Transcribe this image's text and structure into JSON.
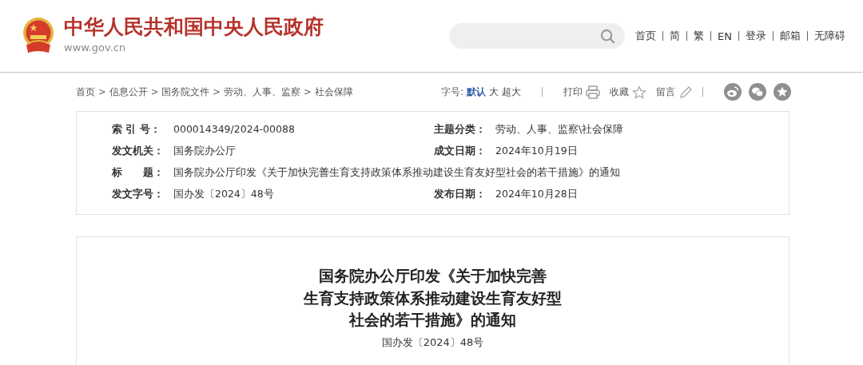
{
  "header": {
    "site_title": "中华人民共和国中央人民政府",
    "site_url": "www.gov.cn",
    "nav": [
      {
        "label": "首页"
      },
      {
        "label": "简"
      },
      {
        "label": "繁"
      },
      {
        "label": "EN"
      },
      {
        "label": "登录"
      },
      {
        "label": "邮箱"
      },
      {
        "label": "无障碍"
      }
    ]
  },
  "breadcrumb": {
    "separator": ">",
    "items": [
      {
        "label": "首页"
      },
      {
        "label": "信息公开"
      },
      {
        "label": "国务院文件"
      },
      {
        "label": "劳动、人事、监察"
      },
      {
        "label": "社会保障"
      }
    ]
  },
  "toolbar": {
    "font_label": "字号:",
    "font_sizes": [
      {
        "label": "默认",
        "selected": true
      },
      {
        "label": "大",
        "selected": false
      },
      {
        "label": "超大",
        "selected": false
      }
    ],
    "actions": [
      {
        "label": "打印",
        "kind": "print"
      },
      {
        "label": "收藏",
        "kind": "favorite"
      },
      {
        "label": "留言",
        "kind": "comment"
      }
    ],
    "share": [
      {
        "kind": "weibo"
      },
      {
        "kind": "wechat"
      },
      {
        "kind": "star"
      }
    ]
  },
  "meta": [
    {
      "label": "索 引 号：",
      "value": "000014349/2024-00088",
      "kind": "half"
    },
    {
      "label": "主题分类：",
      "value": "劳动、人事、监察\\社会保障",
      "kind": "half"
    },
    {
      "label": "发文机关：",
      "value": "国务院办公厅",
      "kind": "half"
    },
    {
      "label": "成文日期：",
      "value": "2024年10月19日",
      "kind": "half"
    },
    {
      "label": "标　　题：",
      "value": "国务院办公厅印发《关于加快完善生育支持政策体系推动建设生育友好型社会的若干措施》的通知",
      "kind": "full"
    },
    {
      "label": "发文字号：",
      "value": "国办发〔2024〕48号",
      "kind": "half"
    },
    {
      "label": "发布日期：",
      "value": "2024年10月28日",
      "kind": "half"
    }
  ],
  "article": {
    "title_lines": [
      "国务院办公厅印发《关于加快完善",
      "生育支持政策体系推动建设生育友好型",
      "社会的若干措施》的通知"
    ],
    "doc_number": "国办发〔2024〕48号"
  }
}
